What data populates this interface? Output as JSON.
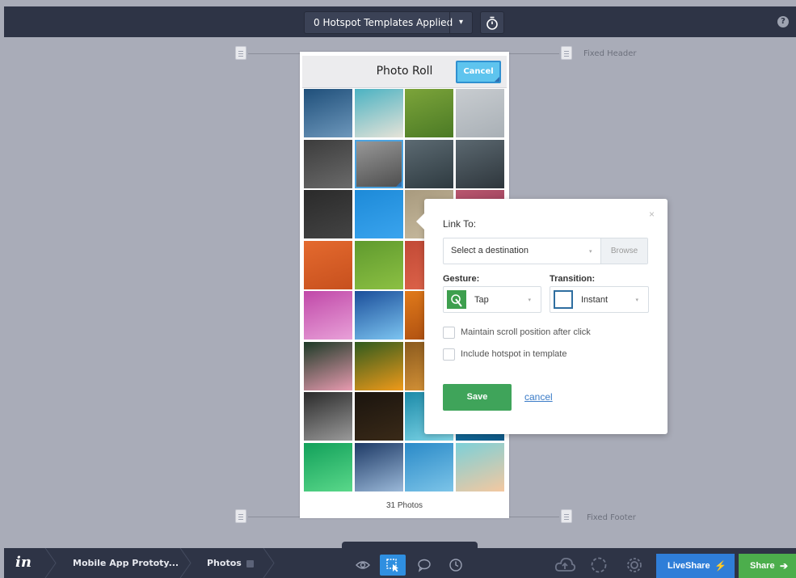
{
  "topbar": {
    "templates_label": "0 Hotspot Templates Applied",
    "caret": "▾",
    "help": "?"
  },
  "guides": {
    "header_label": "Fixed Header",
    "footer_label": "Fixed Footer"
  },
  "screen": {
    "title": "Photo Roll",
    "cancel_label": "Cancel",
    "photo_count": "31 Photos",
    "selected_tile_index": 5,
    "tiles": [
      {
        "colors": [
          "#1f4f7a",
          "#6d97bb"
        ]
      },
      {
        "colors": [
          "#4bb2c2",
          "#e6e3d8"
        ]
      },
      {
        "colors": [
          "#7ca43a",
          "#4b7a25"
        ]
      },
      {
        "colors": [
          "#c8ccd0",
          "#a9b0b6"
        ]
      },
      {
        "colors": [
          "#3c3c3c",
          "#6a6a6a"
        ]
      },
      {
        "colors": [
          "#9a9a9a",
          "#4c4c4c"
        ]
      },
      {
        "colors": [
          "#5c6a72",
          "#2e3a40"
        ]
      },
      {
        "colors": [
          "#5b6870",
          "#2e363c"
        ]
      },
      {
        "colors": [
          "#2a2a2a",
          "#444444"
        ]
      },
      {
        "colors": [
          "#1d8ad8",
          "#3aa4ee"
        ]
      },
      {
        "colors": [
          "#a89a7e",
          "#c9bca0"
        ]
      },
      {
        "colors": [
          "#b8566e",
          "#8a3450"
        ]
      },
      {
        "colors": [
          "#e46a2e",
          "#c7501e"
        ]
      },
      {
        "colors": [
          "#5f9a2e",
          "#8cc043"
        ]
      },
      {
        "colors": [
          "#c24a36",
          "#e0664c"
        ]
      },
      {
        "colors": [
          "#e0664c",
          "#b84030"
        ]
      },
      {
        "colors": [
          "#c048a8",
          "#e8a0d8"
        ]
      },
      {
        "colors": [
          "#1b4e9a",
          "#7cc4f0"
        ]
      },
      {
        "colors": [
          "#e07a1a",
          "#a84a10"
        ]
      },
      {
        "colors": [
          "#c06a1a",
          "#e08a2a"
        ]
      },
      {
        "colors": [
          "#1c3a26",
          "#e89ab0"
        ]
      },
      {
        "colors": [
          "#2f5a1e",
          "#f09a1a"
        ]
      },
      {
        "colors": [
          "#8a5a1e",
          "#e09a3a"
        ]
      },
      {
        "colors": [
          "#b0782a",
          "#6a4418"
        ]
      },
      {
        "colors": [
          "#2a2a2a",
          "#9a9a9a"
        ]
      },
      {
        "colors": [
          "#1a140e",
          "#3a2a18"
        ]
      },
      {
        "colors": [
          "#1c8aa8",
          "#7fd6e8"
        ]
      },
      {
        "colors": [
          "#1a8ab8",
          "#0e5a8a"
        ]
      },
      {
        "colors": [
          "#12a05a",
          "#5ad88a"
        ]
      },
      {
        "colors": [
          "#1e3a66",
          "#9ab8d8"
        ]
      },
      {
        "colors": [
          "#2a8ac8",
          "#7cc4e8"
        ]
      },
      {
        "colors": [
          "#7cd0d8",
          "#f4c8a0"
        ]
      }
    ]
  },
  "popover": {
    "close": "×",
    "link_to_label": "Link To:",
    "destination_placeholder": "Select a destination",
    "browse_label": "Browse",
    "gesture_label": "Gesture:",
    "gesture_value": "Tap",
    "transition_label": "Transition:",
    "transition_value": "Instant",
    "caret": "▾",
    "maintain_scroll_label": "Maintain scroll position after click",
    "maintain_scroll_checked": false,
    "include_template_label": "Include hotspot in template",
    "include_template_checked": false,
    "save_label": "Save",
    "cancel_label": "cancel"
  },
  "bottombar": {
    "logo": "in",
    "project": "Mobile App Prototy...",
    "screen": "Photos",
    "active_tool": "build",
    "liveshare_label": "LiveShare",
    "share_label": "Share",
    "liveshare_glyph": "⚡",
    "share_glyph": "➔"
  }
}
